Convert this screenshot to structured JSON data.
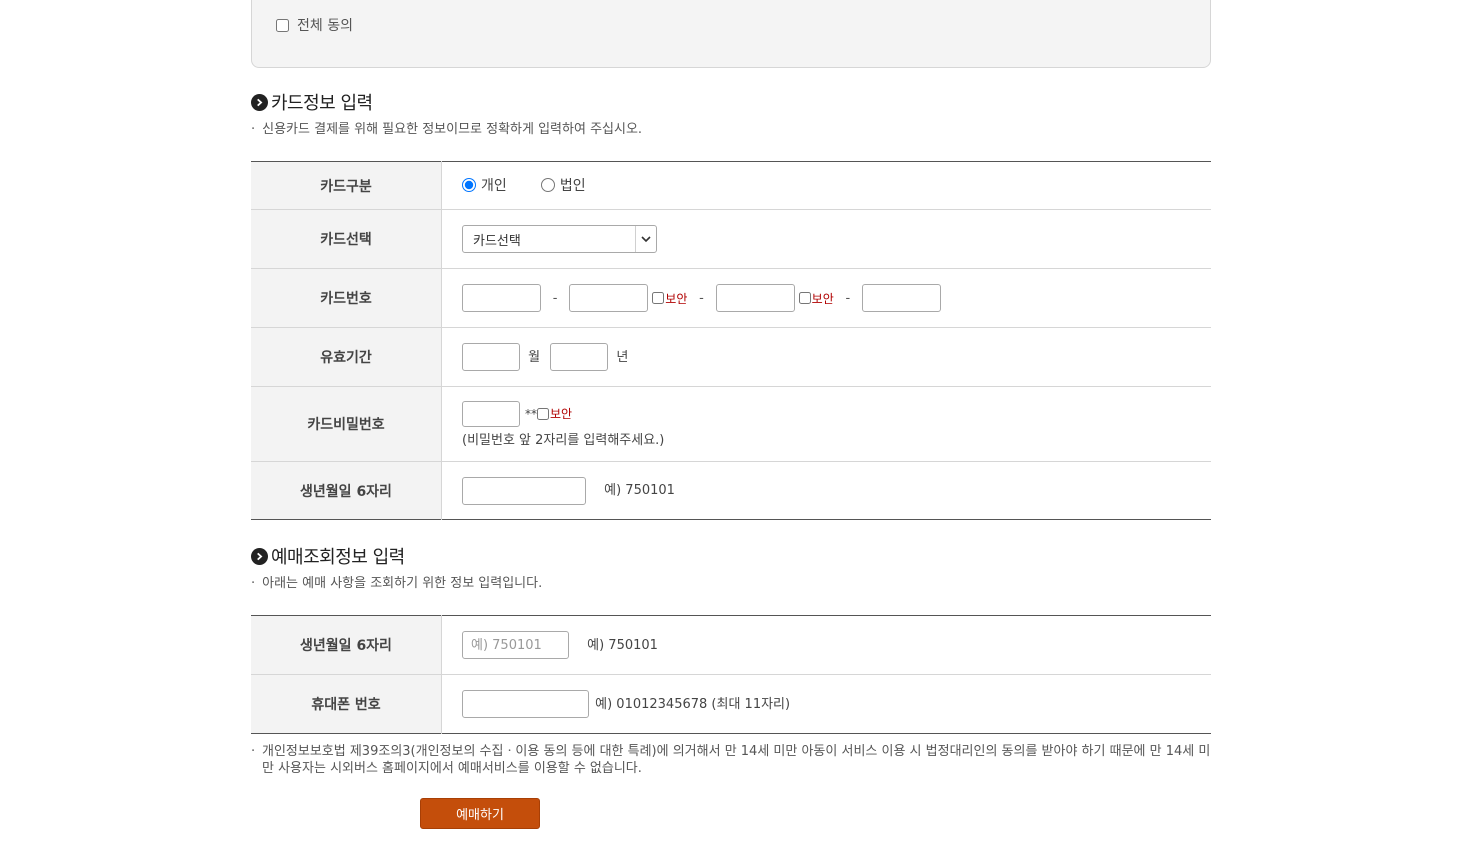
{
  "agree": {
    "all_label": "전체 동의"
  },
  "card_section": {
    "title": "카드정보 입력",
    "desc": "신용카드 결제를 위해 필요한 정보이므로 정확하게 입력하여 주십시오.",
    "rows": {
      "card_type_label": "카드구분",
      "card_type_options": [
        "개인",
        "법인"
      ],
      "card_select_label": "카드선택",
      "card_select_value": "카드선택",
      "card_number_label": "카드번호",
      "secure_label": "보안",
      "expiry_label": "유효기간",
      "month_unit": "월",
      "year_unit": "년",
      "password_label": "카드비밀번호",
      "password_mask": "**",
      "password_hint": "(비밀번호 앞 2자리를 입력해주세요.)",
      "birth_label": "생년월일 6자리",
      "birth_example": "예) 750101"
    }
  },
  "lookup_section": {
    "title": "예매조회정보 입력",
    "desc": "아래는 예매 사항을 조회하기 위한 정보 입력입니다.",
    "rows": {
      "birth_label": "생년월일 6자리",
      "birth_placeholder": "예) 750101",
      "birth_example": "예) 750101",
      "phone_label": "휴대폰 번호",
      "phone_example": "예) 01012345678 (최대 11자리)"
    }
  },
  "notice": "개인정보보호법 제39조의3(개인정보의 수집ㆍ이용 동의 등에 대한 특례)에 의거해서 만 14세 미만 아동이 서비스 이용 시 법정대리인의 동의를 받아야 하기 때문에 만 14세 미만 사용자는 시외버스 홈페이지에서 예매서비스를 이용할 수 없습니다.",
  "bullet": "·",
  "submit_label": "예매하기",
  "colors": {
    "accent": "#c44e0b",
    "secure_red": "#b00000"
  }
}
